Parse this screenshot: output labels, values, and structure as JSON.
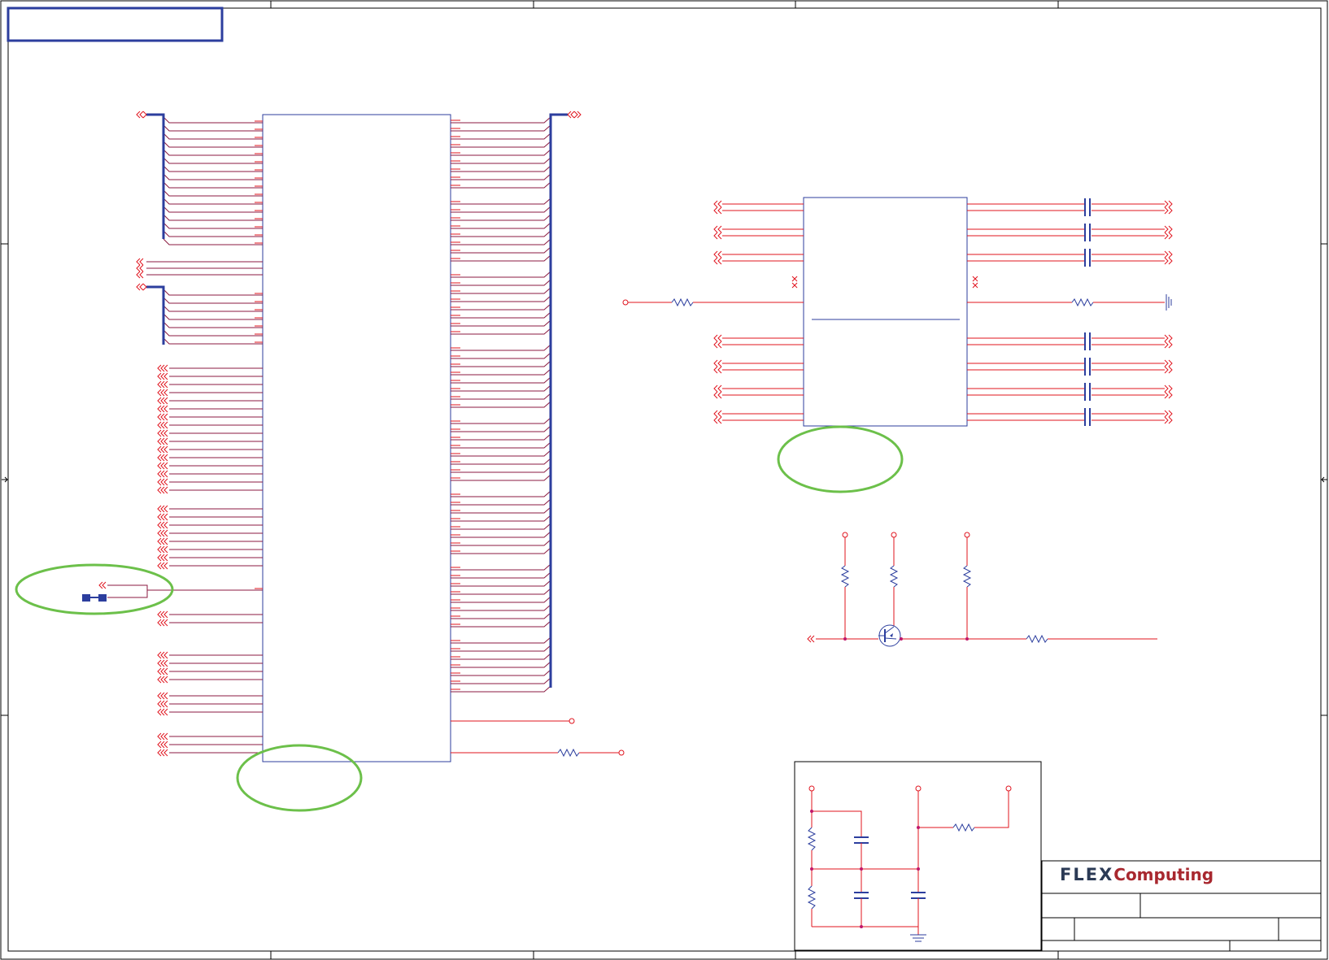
{
  "sheet": {
    "title_box_text": "",
    "logo": {
      "brand_part1": "FLEX",
      "brand_part2": "Computing"
    }
  },
  "colors": {
    "frame": "#000000",
    "component": "#2c3e9e",
    "wire": "#e0141e",
    "net": "#8b1a40",
    "bus": "#2c3e9e",
    "junction": "#c0176b",
    "highlight": "#6cc04a"
  },
  "highlights": [
    "left-pin-area",
    "main-ic-bottom",
    "right-ic-bottom"
  ]
}
